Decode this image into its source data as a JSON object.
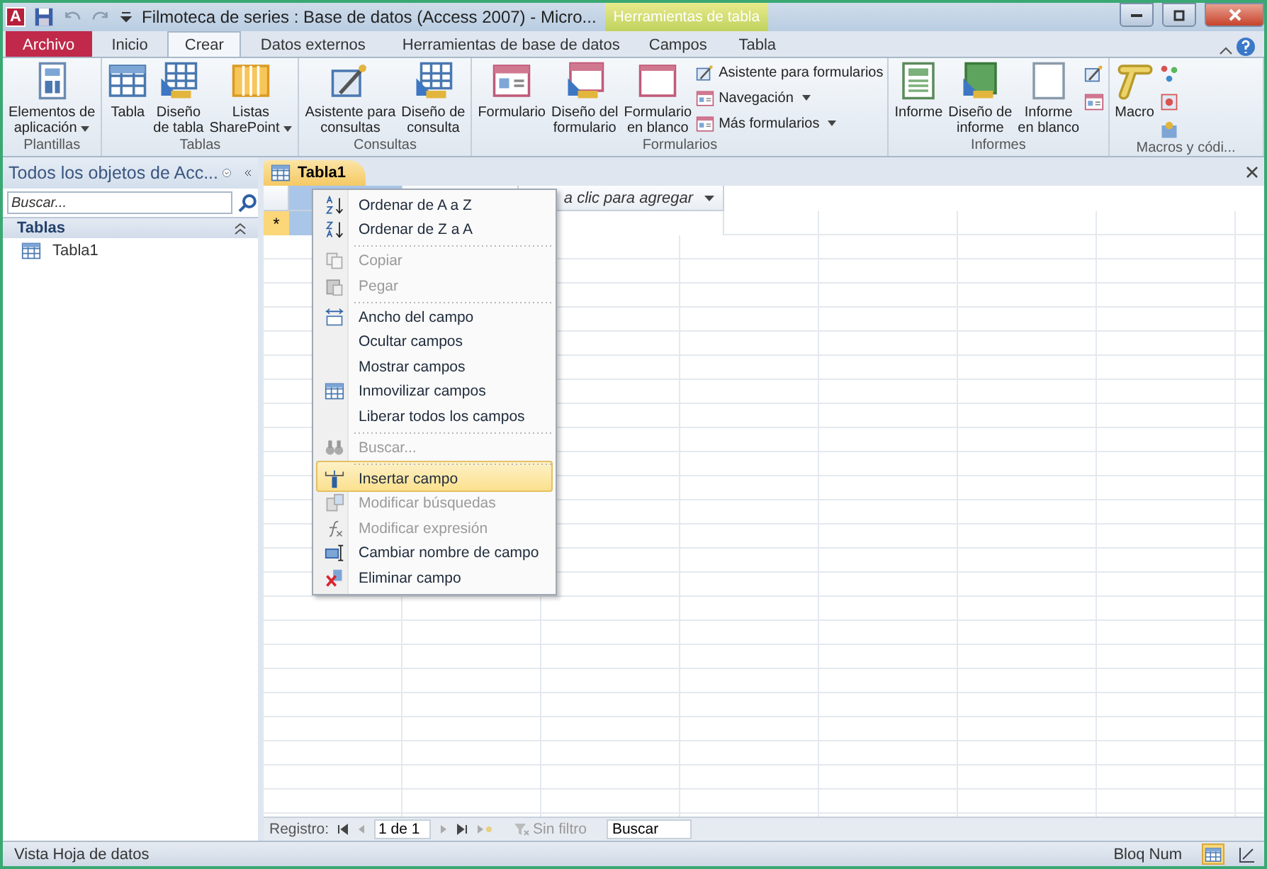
{
  "window": {
    "app_letter": "A",
    "title": "Filmoteca de series : Base de datos (Access 2007)  -  Micro...",
    "context_group": "Herramientas de tabla"
  },
  "tabs": [
    {
      "label": "Archivo",
      "kind": "file",
      "selected": false
    },
    {
      "label": "Inicio",
      "kind": "tab",
      "selected": false
    },
    {
      "label": "Crear",
      "kind": "tab",
      "selected": true
    },
    {
      "label": "Datos externos",
      "kind": "tab",
      "selected": false
    },
    {
      "label": "Herramientas de base de datos",
      "kind": "tab",
      "selected": false
    },
    {
      "label": "Campos",
      "kind": "context",
      "selected": false
    },
    {
      "label": "Tabla",
      "kind": "context",
      "selected": false
    }
  ],
  "ribbon": [
    {
      "name": "Plantillas",
      "buttons": [
        {
          "kind": "large",
          "lines": [
            "Elementos de",
            "aplicación"
          ],
          "dropdown": true
        }
      ]
    },
    {
      "name": "Tablas",
      "buttons": [
        {
          "kind": "large",
          "lines": [
            "Tabla"
          ],
          "dropdown": false
        },
        {
          "kind": "large",
          "lines": [
            "Diseño",
            "de tabla"
          ],
          "dropdown": false
        },
        {
          "kind": "large",
          "lines": [
            "Listas",
            "SharePoint"
          ],
          "dropdown": true
        }
      ]
    },
    {
      "name": "Consultas",
      "buttons": [
        {
          "kind": "large",
          "lines": [
            "Asistente para",
            "consultas"
          ],
          "dropdown": false
        },
        {
          "kind": "large",
          "lines": [
            "Diseño de",
            "consulta"
          ],
          "dropdown": false
        }
      ]
    },
    {
      "name": "Formularios",
      "buttons": [
        {
          "kind": "large",
          "lines": [
            "Formulario"
          ],
          "dropdown": false
        },
        {
          "kind": "large",
          "lines": [
            "Diseño del",
            "formulario"
          ],
          "dropdown": false
        },
        {
          "kind": "large",
          "lines": [
            "Formulario",
            "en blanco"
          ],
          "dropdown": false
        },
        {
          "kind": "small",
          "lines": [
            "Asistente para formularios"
          ],
          "dropdown": false
        },
        {
          "kind": "small",
          "lines": [
            "Navegación"
          ],
          "dropdown": true
        },
        {
          "kind": "small",
          "lines": [
            "Más formularios"
          ],
          "dropdown": true
        }
      ]
    },
    {
      "name": "Informes",
      "buttons": [
        {
          "kind": "large",
          "lines": [
            "Informe"
          ],
          "dropdown": false
        },
        {
          "kind": "large",
          "lines": [
            "Diseño de",
            "informe"
          ],
          "dropdown": false
        },
        {
          "kind": "large",
          "lines": [
            "Informe",
            "en blanco"
          ],
          "dropdown": false
        },
        {
          "kind": "mini"
        },
        {
          "kind": "mini"
        }
      ]
    },
    {
      "name": "Macros y códi...",
      "buttons": [
        {
          "kind": "large",
          "lines": [
            "Macro"
          ],
          "dropdown": false
        },
        {
          "kind": "mini"
        },
        {
          "kind": "mini"
        },
        {
          "kind": "mini"
        }
      ]
    }
  ],
  "nav_pane": {
    "title": "Todos los objetos de Acc...",
    "search": {
      "placeholder": "Buscar..."
    },
    "groups": [
      {
        "label": "Tablas",
        "expanded": true,
        "items": [
          {
            "label": "Tabla1",
            "selected": false
          }
        ]
      }
    ]
  },
  "document_tab": {
    "label": "Tabla1",
    "selected": true
  },
  "datasheet": {
    "add_column": "a clic para agregar",
    "new_row_marker": "*"
  },
  "context_menu": [
    {
      "label": "Ordenar de A a Z",
      "disabled": false,
      "selected": false,
      "separator_before": false
    },
    {
      "label": "Ordenar de Z a A",
      "disabled": false,
      "selected": false,
      "separator_before": false
    },
    {
      "label": "Copiar",
      "disabled": true,
      "selected": false,
      "separator_before": true
    },
    {
      "label": "Pegar",
      "disabled": true,
      "selected": false,
      "separator_before": false
    },
    {
      "label": "Ancho del campo",
      "disabled": false,
      "selected": false,
      "separator_before": true
    },
    {
      "label": "Ocultar campos",
      "disabled": false,
      "selected": false,
      "separator_before": false
    },
    {
      "label": "Mostrar campos",
      "disabled": false,
      "selected": false,
      "separator_before": false
    },
    {
      "label": "Inmovilizar campos",
      "disabled": false,
      "selected": false,
      "separator_before": false
    },
    {
      "label": "Liberar todos los campos",
      "disabled": false,
      "selected": false,
      "separator_before": false
    },
    {
      "label": "Buscar...",
      "disabled": true,
      "selected": false,
      "separator_before": true
    },
    {
      "label": "Insertar campo",
      "disabled": false,
      "selected": true,
      "separator_before": true
    },
    {
      "label": "Modificar búsquedas",
      "disabled": true,
      "selected": false,
      "separator_before": false
    },
    {
      "label": "Modificar expresión",
      "disabled": true,
      "selected": false,
      "separator_before": false
    },
    {
      "label": "Cambiar nombre de campo",
      "disabled": false,
      "selected": false,
      "separator_before": false
    },
    {
      "label": "Eliminar campo",
      "disabled": false,
      "selected": false,
      "separator_before": false
    }
  ],
  "record_nav": {
    "label": "Registro:",
    "position": "1 de 1",
    "filter": "Sin filtro",
    "search": "Buscar"
  },
  "status_bar": {
    "left": "Vista Hoja de datos",
    "right": "Bloq Num"
  }
}
